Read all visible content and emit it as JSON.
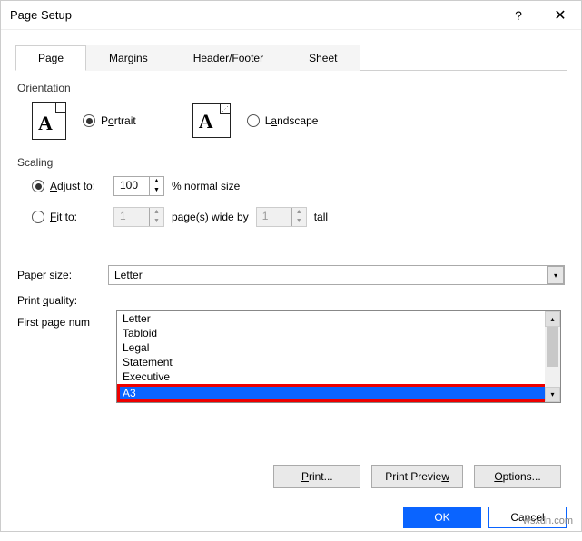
{
  "titlebar": {
    "title": "Page Setup",
    "help": "?",
    "close": "✕"
  },
  "tabs": {
    "page": "Page",
    "margins": "Margins",
    "headerfooter": "Header/Footer",
    "sheet": "Sheet"
  },
  "orientation": {
    "section": "Orientation",
    "portrait": "Portrait",
    "landscape": "Landscape",
    "glyph": "A"
  },
  "scaling": {
    "section": "Scaling",
    "adjust_label_prefix": "Adjust to:",
    "adjust_value": "100",
    "adjust_suffix": "% normal size",
    "fit_label": "Fit to:",
    "fit_wide_value": "1",
    "fit_wide_suffix": "page(s) wide by",
    "fit_tall_value": "1",
    "fit_tall_suffix": "tall"
  },
  "paper": {
    "label": "Paper size:",
    "value": "Letter"
  },
  "quality": {
    "label": "Print quality:"
  },
  "firstpage": {
    "label": "First page num"
  },
  "dropdown": {
    "items": [
      "Letter",
      "Tabloid",
      "Legal",
      "Statement",
      "Executive",
      "A3"
    ],
    "highlighted_index": 5
  },
  "buttons": {
    "print": "Print...",
    "preview": "Print Preview",
    "options": "Options..."
  },
  "footer": {
    "ok": "OK",
    "cancel": "Cancel"
  },
  "watermark": "wsxdn.com"
}
